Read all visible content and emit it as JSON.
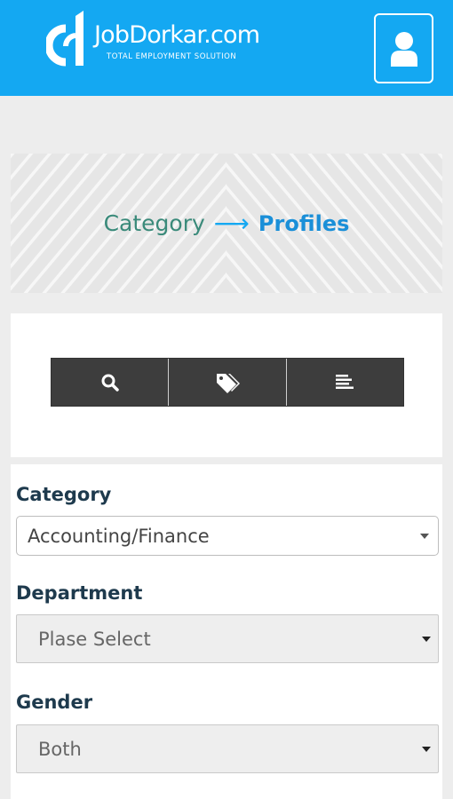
{
  "header": {
    "brand_name": "JobDorkar.com",
    "tagline": "TOTAL EMPLOYMENT SOLUTION",
    "user_icon": "user-icon",
    "accent_color": "#14a8f2"
  },
  "breadcrumb": {
    "category": "Category",
    "arrow": "⟶",
    "current": "Profiles"
  },
  "toolbar": {
    "buttons": [
      {
        "icon": "search-icon"
      },
      {
        "icon": "tags-icon"
      },
      {
        "icon": "list-icon"
      }
    ]
  },
  "form": {
    "category": {
      "label": "Category",
      "value": "Accounting/Finance"
    },
    "department": {
      "label": "Department",
      "value": "Plase Select"
    },
    "gender": {
      "label": "Gender",
      "value": "Both"
    }
  }
}
